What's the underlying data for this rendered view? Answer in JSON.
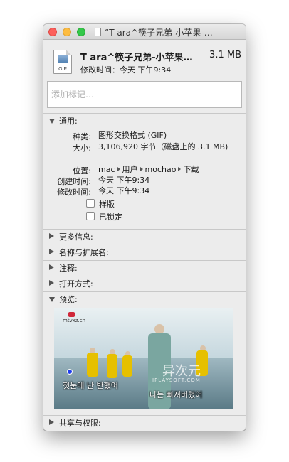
{
  "window": {
    "title": "“T ara^筷子兄弟-小苹果-…"
  },
  "header": {
    "file_name": "T ara^筷子兄弟-小苹果…",
    "file_size": "3.1 MB",
    "modified_summary": "修改时间：今天 下午9:34",
    "icon_ext": "GIF"
  },
  "tags": {
    "placeholder": "添加标记…"
  },
  "general": {
    "label": "通用:",
    "rows": {
      "kind": {
        "key": "种类:",
        "value": "图形交换格式 (GIF)"
      },
      "size": {
        "key": "大小:",
        "value": "3,106,920 字节（磁盘上的 3.1 MB)"
      },
      "where": {
        "key": "位置:",
        "path": [
          "mac",
          "用户",
          "mochao",
          "下载"
        ]
      },
      "created": {
        "key": "创建时间:",
        "value": "今天 下午9:34"
      },
      "modified": {
        "key": "修改时间:",
        "value": "今天 下午9:34"
      }
    },
    "checkboxes": {
      "stationery": {
        "label": "样版",
        "checked": false
      },
      "locked": {
        "label": "已锁定",
        "checked": false
      }
    }
  },
  "sections": {
    "more_info": "更多信息:",
    "name_ext": "名称与扩展名:",
    "comments": "注释:",
    "open_with": "打开方式:",
    "preview": "预览:",
    "sharing": "共享与权限:"
  },
  "preview": {
    "site": "mtvxz.cn",
    "subtitle_1": "첫눈에 난 반했어",
    "subtitle_2": "나는 빠져버렸어",
    "watermark_main": "异次元",
    "watermark_sub": "IPLAYSOFT.COM"
  },
  "colors": {
    "close": "#fc605c",
    "minimize": "#fdbc40",
    "zoom": "#34c84a",
    "window_bg": "#ececec"
  }
}
